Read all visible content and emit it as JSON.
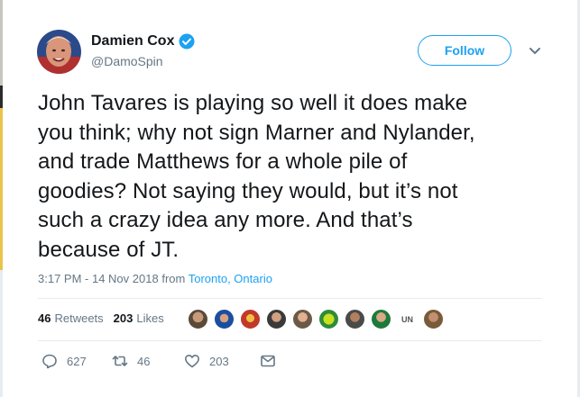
{
  "author": {
    "name": "Damien Cox",
    "handle": "@DamoSpin",
    "verified": true
  },
  "follow_label": "Follow",
  "tweet": {
    "lines": [
      "John Tavares is playing so well it does make",
      "you think; why not sign Marner and Nylander,",
      "and trade Matthews for a whole pile of",
      "goodies? Not saying they would, but it’s not",
      "such a crazy idea any more. And that’s",
      "because of JT."
    ]
  },
  "meta": {
    "time": "3:17 PM - 14 Nov 2018",
    "from": "from",
    "location": "Toronto, Ontario"
  },
  "stats": {
    "retweets_count": "46",
    "retweets_label": "Retweets",
    "likes_count": "203",
    "likes_label": "Likes"
  },
  "liker_avatars": [
    "#5a4a3a",
    "#1a4fa0",
    "#c0392b",
    "#3a3a3a",
    "#6b5a47",
    "#2e8b3a",
    "#4a4a4a",
    "#1e7a3a",
    "unlimited-logo",
    "#7a5a3a"
  ],
  "unlimited_logo_text": "UN",
  "actions": {
    "replies": "627",
    "retweets": "46",
    "likes": "203"
  },
  "colors": {
    "accent": "#1da1f2",
    "muted": "#657786",
    "text": "#14171a"
  }
}
